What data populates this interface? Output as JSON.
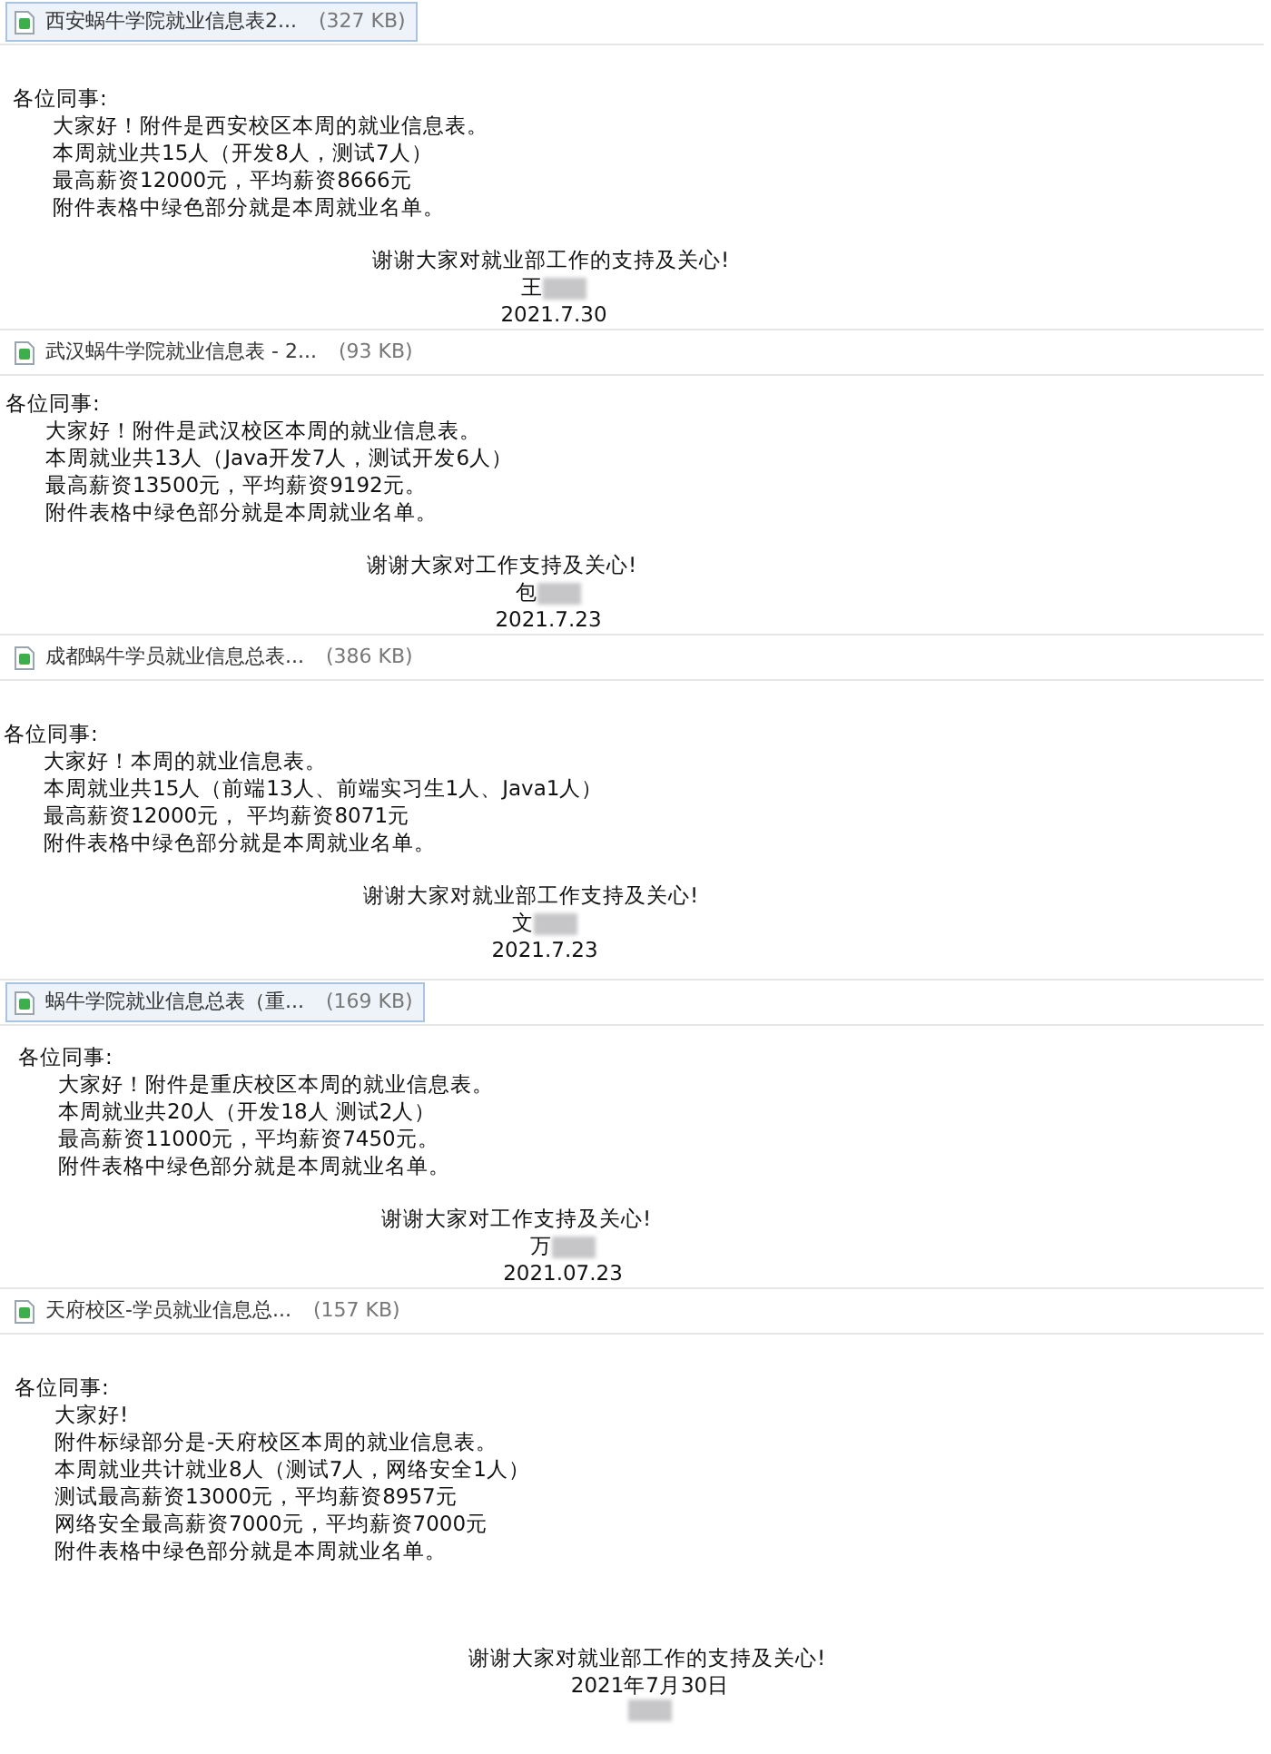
{
  "emails": [
    {
      "attachment": {
        "name": "西安蜗牛学院就业信息表2...",
        "size": "(327 KB)",
        "selected": true
      },
      "greeting": "各位同事:",
      "lines": [
        "大家好！附件是西安校区本周的就业信息表。",
        "本周就业共15人（开发8人，测试7人）",
        "最高薪资12000元，平均薪资8666元",
        "附件表格中绿色部分就是本周就业名单。"
      ],
      "sign": [
        {
          "kind": "text",
          "text": "谢谢大家对就业部工作的支持及关心!"
        },
        {
          "kind": "name",
          "text": "王"
        },
        {
          "kind": "text",
          "text": "2021.7.30"
        }
      ]
    },
    {
      "attachment": {
        "name": "武汉蜗牛学院就业信息表 - 2...",
        "size": "(93 KB)",
        "selected": false
      },
      "greeting": "各位同事:",
      "lines": [
        "大家好！附件是武汉校区本周的就业信息表。",
        "本周就业共13人（Java开发7人，测试开发6人）",
        "最高薪资13500元，平均薪资9192元。",
        "附件表格中绿色部分就是本周就业名单。"
      ],
      "sign": [
        {
          "kind": "text",
          "text": "谢谢大家对工作支持及关心!"
        },
        {
          "kind": "name",
          "text": "包"
        },
        {
          "kind": "text",
          "text": "2021.7.23"
        }
      ]
    },
    {
      "attachment": {
        "name": "成都蜗牛学员就业信息总表...",
        "size": "(386 KB)",
        "selected": false
      },
      "greeting": "各位同事:",
      "lines": [
        "大家好！本周的就业信息表。",
        "本周就业共15人（前端13人、前端实习生1人、Java1人）",
        "最高薪资12000元， 平均薪资8071元",
        "附件表格中绿色部分就是本周就业名单。"
      ],
      "sign": [
        {
          "kind": "text",
          "text": "谢谢大家对就业部工作支持及关心!"
        },
        {
          "kind": "name",
          "text": "文"
        },
        {
          "kind": "text",
          "text": "2021.7.23"
        }
      ]
    },
    {
      "attachment": {
        "name": "蜗牛学院就业信息总表（重...",
        "size": "(169 KB)",
        "selected": true
      },
      "greeting": "各位同事:",
      "lines": [
        "大家好！附件是重庆校区本周的就业信息表。",
        "本周就业共20人（开发18人 测试2人）",
        "最高薪资11000元，平均薪资7450元。",
        "附件表格中绿色部分就是本周就业名单。"
      ],
      "sign": [
        {
          "kind": "text",
          "text": "谢谢大家对工作支持及关心!"
        },
        {
          "kind": "name",
          "text": "万"
        },
        {
          "kind": "text",
          "text": "2021.07.23"
        }
      ]
    },
    {
      "attachment": {
        "name": "天府校区-学员就业信息总...",
        "size": "(157 KB)",
        "selected": false
      },
      "greeting": "各位同事:",
      "lines": [
        "大家好!",
        "附件标绿部分是-天府校区本周的就业信息表。",
        "本周就业共计就业8人（测试7人，网络安全1人）",
        "测试最高薪资13000元，平均薪资8957元",
        "网络安全最高薪资7000元，平均薪资7000元",
        "附件表格中绿色部分就是本周就业名单。"
      ],
      "sign": [
        {
          "kind": "text",
          "text": "谢谢大家对就业部工作的支持及关心!"
        },
        {
          "kind": "text",
          "text": "2021年7月30日"
        },
        {
          "kind": "name"
        }
      ]
    }
  ]
}
